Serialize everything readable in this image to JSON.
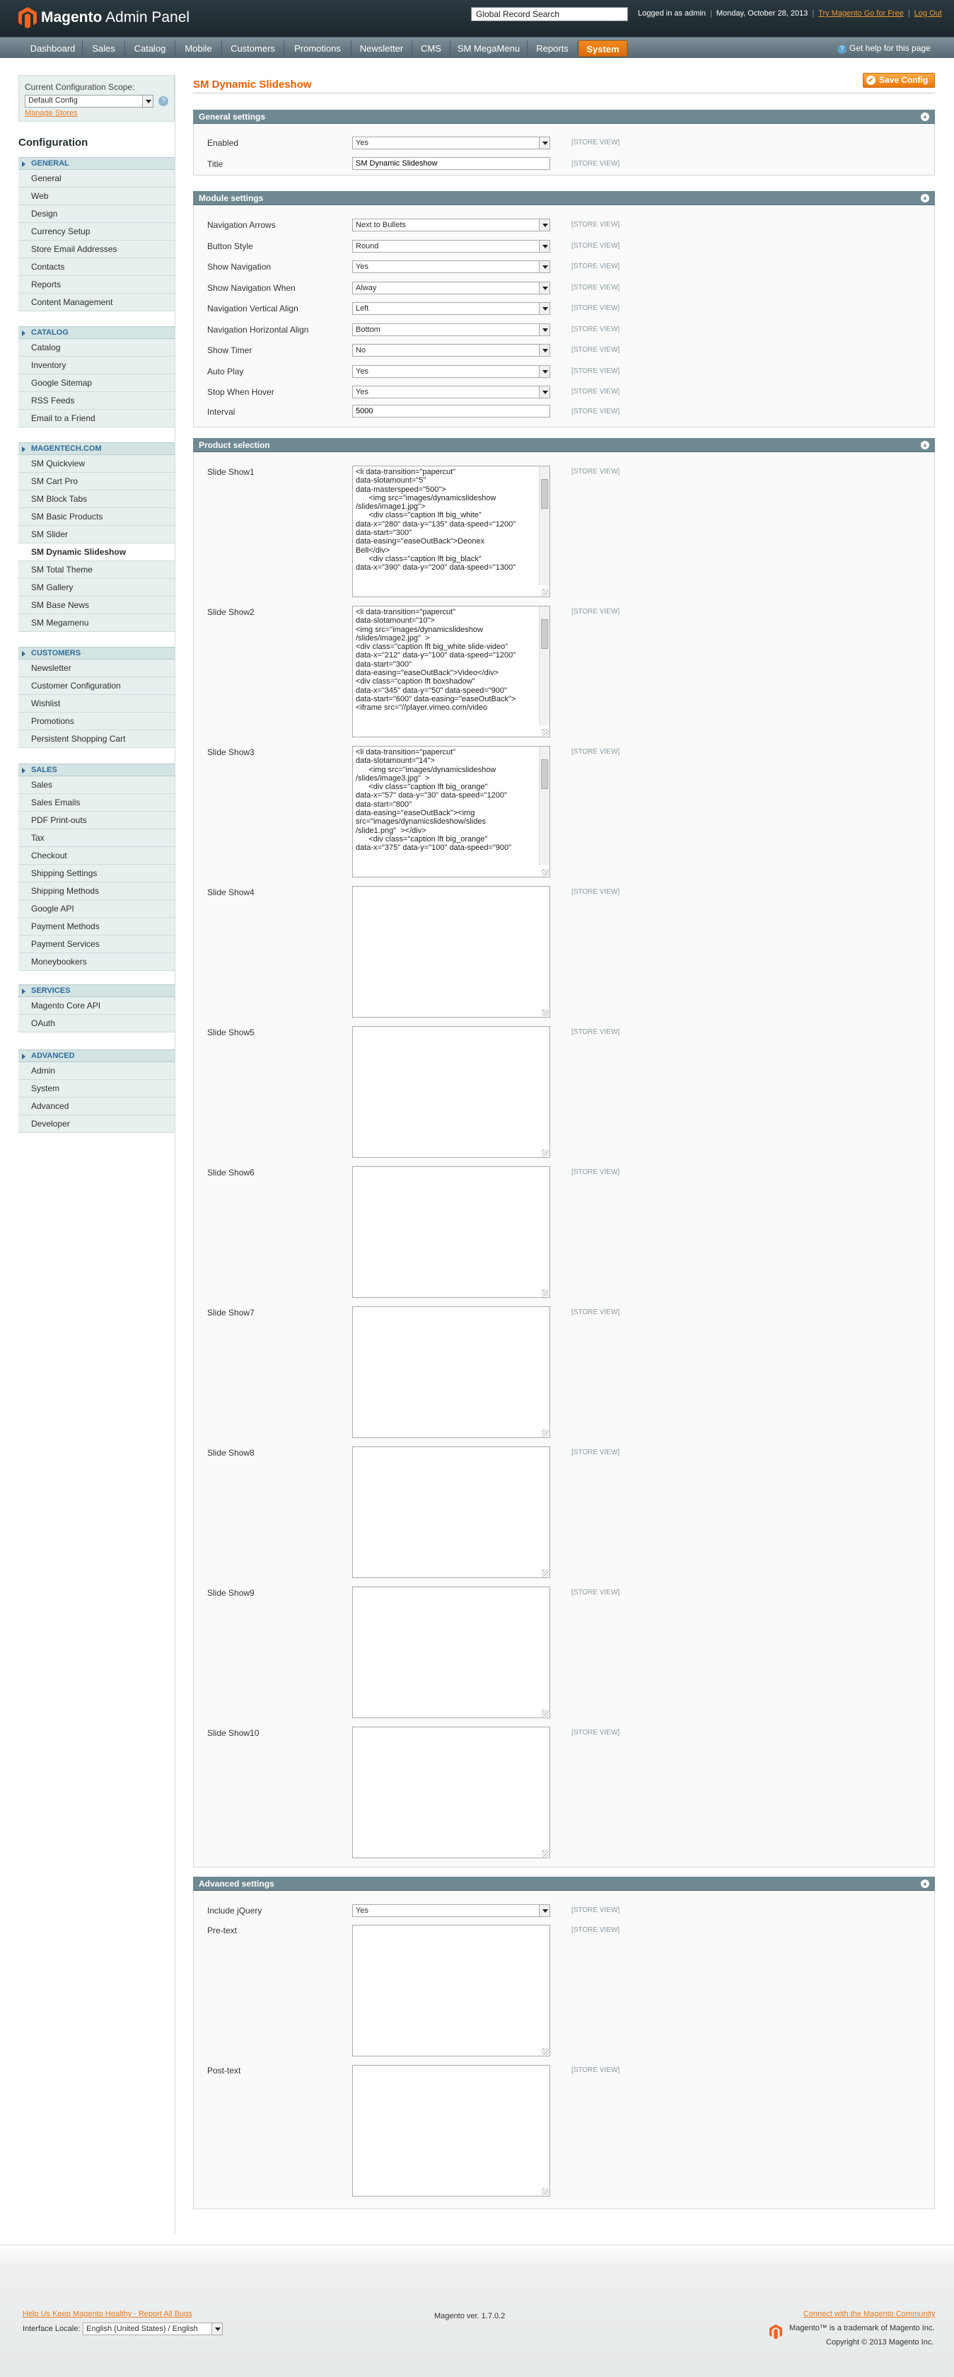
{
  "header": {
    "logo_bold": "Magento",
    "logo_rest": " Admin Panel",
    "search_value": "Global Record Search",
    "logged_in": "Logged in as admin",
    "date": "Monday, October 28, 2013",
    "try_link": "Try Magento Go for Free",
    "logout": "Log Out"
  },
  "nav": {
    "items": [
      "Dashboard",
      "Sales",
      "Catalog",
      "Mobile",
      "Customers",
      "Promotions",
      "Newsletter",
      "CMS",
      "SM MegaMenu",
      "Reports",
      "System"
    ],
    "help": "Get help for this page"
  },
  "sidebar": {
    "scope_label": "Current Configuration Scope:",
    "scope_value": "Default Config",
    "manage_stores": "Manage Stores",
    "config_title": "Configuration",
    "groups": [
      {
        "title": "GENERAL",
        "items": [
          "General",
          "Web",
          "Design",
          "Currency Setup",
          "Store Email Addresses",
          "Contacts",
          "Reports",
          "Content Management"
        ]
      },
      {
        "title": "CATALOG",
        "items": [
          "Catalog",
          "Inventory",
          "Google Sitemap",
          "RSS Feeds",
          "Email to a Friend"
        ]
      },
      {
        "title": "MAGENTECH.COM",
        "items": [
          "SM Quickview",
          "SM Cart Pro",
          "SM Block Tabs",
          "SM Basic Products",
          "SM Slider",
          "SM Dynamic Slideshow",
          "SM Total Theme",
          "SM Gallery",
          "SM Base News",
          "SM Megamenu"
        ]
      },
      {
        "title": "CUSTOMERS",
        "items": [
          "Newsletter",
          "Customer Configuration",
          "Wishlist",
          "Promotions",
          "Persistent Shopping Cart"
        ]
      },
      {
        "title": "SALES",
        "items": [
          "Sales",
          "Sales Emails",
          "PDF Print-outs",
          "Tax",
          "Checkout",
          "Shipping Settings",
          "Shipping Methods",
          "Google API",
          "Payment Methods",
          "Payment Services",
          "Moneybookers"
        ]
      },
      {
        "title": "SERVICES",
        "items": [
          "Magento Core API",
          "OAuth"
        ]
      },
      {
        "title": "ADVANCED",
        "items": [
          "Admin",
          "System",
          "Advanced",
          "Developer"
        ]
      }
    ]
  },
  "main": {
    "page_title": "SM Dynamic Slideshow",
    "save_label": "Save Config",
    "scope_tag": "[STORE VIEW]",
    "sections": {
      "general": {
        "title": "General settings",
        "enabled_label": "Enabled",
        "enabled_value": "Yes",
        "title_label": "Title",
        "title_value": "SM Dynamic Slideshow"
      },
      "module": {
        "title": "Module settings",
        "fields": [
          {
            "label": "Navigation Arrows",
            "value": "Next to Bullets"
          },
          {
            "label": "Button Style",
            "value": "Round"
          },
          {
            "label": "Show Navigation",
            "value": "Yes"
          },
          {
            "label": "Show Navigation When",
            "value": "Alway"
          },
          {
            "label": "Navigation Vertical Align",
            "value": "Left"
          },
          {
            "label": "Navigation Horizontal Align",
            "value": "Bottom"
          },
          {
            "label": "Show Timer",
            "value": "No"
          },
          {
            "label": "Auto Play",
            "value": "Yes"
          },
          {
            "label": "Stop When Hover",
            "value": "Yes"
          }
        ],
        "interval_label": "Interval",
        "interval_value": "5000"
      },
      "product": {
        "title": "Product selection",
        "slides": [
          {
            "label": "Slide Show1",
            "value": "<li data-transition=\"papercut\"\ndata-slotamount=\"5\"\ndata-masterspeed=\"500\">\n      <img src=\"images/dynamicslideshow\n/slides/image1.jpg\">\n      <div class=\"caption lft big_white\"\ndata-x=\"280\" data-y=\"135\" data-speed=\"1200\"\ndata-start=\"300\"\ndata-easing=\"easeOutBack\">Deonex\nBell</div>\n      <div class=\"caption lft big_black\"\ndata-x=\"390\" data-y=\"200\" data-speed=\"1300\""
          },
          {
            "label": "Slide Show2",
            "value": "<li data-transition=\"papercut\"\ndata-slotamount=\"10\">\n<img src=\"images/dynamicslideshow\n/slides/image2.jpg\"  >\n<div class=\"caption lft big_white slide-video\"\ndata-x=\"212\" data-y=\"100\" data-speed=\"1200\"\ndata-start=\"300\"\ndata-easing=\"easeOutBack\">Video</div>\n<div class=\"caption lft boxshadow\"\ndata-x=\"345\" data-y=\"50\" data-speed=\"900\"\ndata-start=\"600\" data-easing=\"easeOutBack\">\n<iframe src=\"//player.vimeo.com/video"
          },
          {
            "label": "Slide Show3",
            "value": "<li data-transition=\"papercut\"\ndata-slotamount=\"14\">\n      <img src=\"images/dynamicslideshow\n/slides/image3.jpg\"  >\n      <div class=\"caption lft big_orange\"\ndata-x=\"57\" data-y=\"30\" data-speed=\"1200\"\ndata-start=\"800\"\ndata-easing=\"easeOutBack\"><img\nsrc=\"images/dynamicslideshow/slides\n/slide1.png\"  ></div>\n      <div class=\"caption lft big_orange\"\ndata-x=\"375\" data-y=\"100\" data-speed=\"900\""
          },
          {
            "label": "Slide Show4",
            "value": ""
          },
          {
            "label": "Slide Show5",
            "value": ""
          },
          {
            "label": "Slide Show6",
            "value": ""
          },
          {
            "label": "Slide Show7",
            "value": ""
          },
          {
            "label": "Slide Show8",
            "value": ""
          },
          {
            "label": "Slide Show9",
            "value": ""
          },
          {
            "label": "Slide Show10",
            "value": ""
          }
        ]
      },
      "advanced": {
        "title": "Advanced settings",
        "jquery_label": "Include jQuery",
        "jquery_value": "Yes",
        "pretext_label": "Pre-text",
        "pretext_value": "",
        "posttext_label": "Post-text",
        "posttext_value": ""
      }
    }
  },
  "footer": {
    "help_link": "Help Us Keep Magento Healthy - Report All Bugs",
    "locale_label": "Interface Locale:",
    "locale_value": "English (United States) / English",
    "version": "Magento ver. 1.7.0.2",
    "community_link": "Connect with the Magento Community",
    "trademark": "Magento™ is a trademark of Magento Inc.",
    "copyright": "Copyright © 2013 Magento Inc."
  },
  "colors": {
    "accent": "#eb5e00",
    "nav_active": "#e9770b",
    "section_header": "#6f8992",
    "link": "#eb7a1d"
  }
}
